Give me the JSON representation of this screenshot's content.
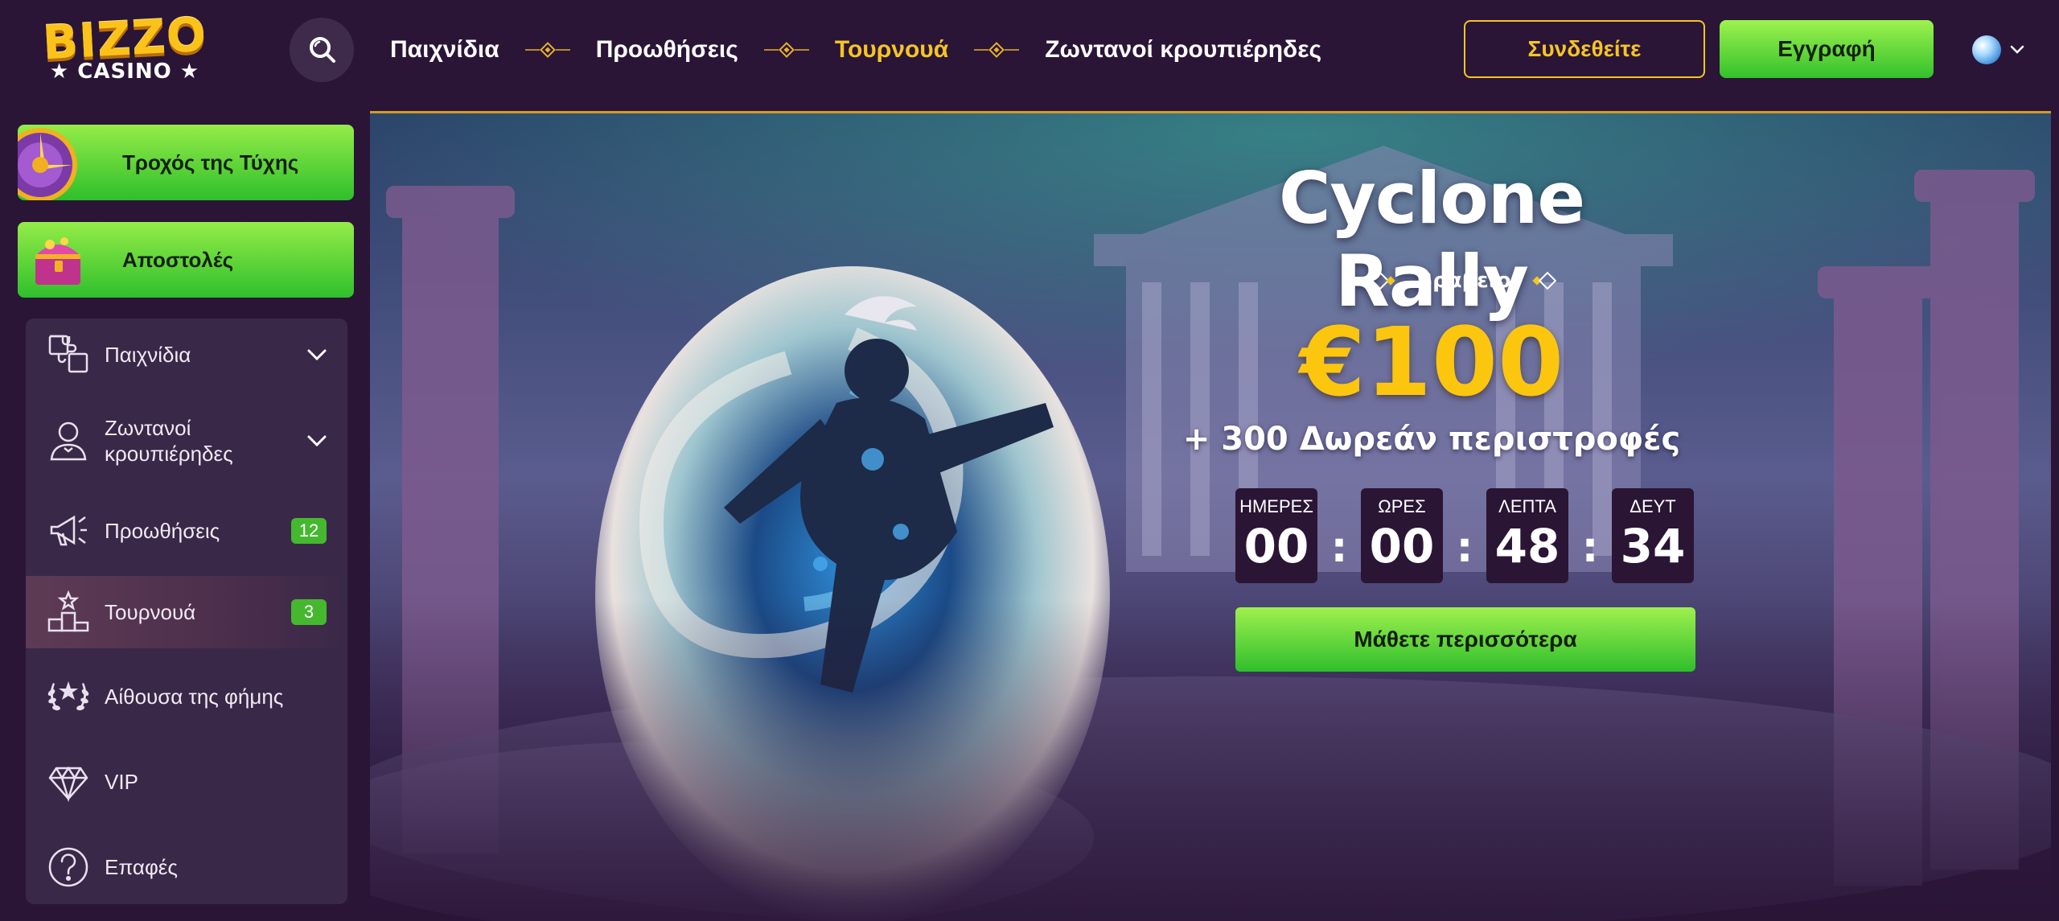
{
  "brand": {
    "logo_line1": "BIZZO",
    "logo_line2": "★ CASINO ★",
    "accent": "#f5c523",
    "green": "#3cc62e",
    "background": "#2a1537"
  },
  "header": {
    "nav": [
      {
        "label": "Παιχνίδια",
        "active": false
      },
      {
        "label": "Προωθήσεις",
        "active": false
      },
      {
        "label": "Τουρνουά",
        "active": true
      },
      {
        "label": "Ζωντανοί κρουπιέρηδες",
        "active": false
      }
    ],
    "login_label": "Συνδεθείτε",
    "register_label": "Εγγραφή",
    "language_icon": "globe-icon"
  },
  "sidebar": {
    "promos": [
      {
        "label": "Τροχός της Τύχης",
        "icon": "wheel-of-fortune-icon"
      },
      {
        "label": "Αποστολές",
        "icon": "treasure-chest-icon"
      }
    ],
    "menu": [
      {
        "label": "Παιχνίδια",
        "icon": "puzzle-icon",
        "expandable": true
      },
      {
        "label": "Ζωντανοί κρουπιέρηδες",
        "icon": "dealer-icon",
        "expandable": true
      },
      {
        "label": "Προωθήσεις",
        "icon": "megaphone-icon",
        "badge": "12"
      },
      {
        "label": "Τουρνουά",
        "icon": "podium-icon",
        "badge": "3",
        "active": true
      },
      {
        "label": "Αίθουσα της φήμης",
        "icon": "laurel-icon"
      },
      {
        "label": "VIP",
        "icon": "diamond-icon"
      },
      {
        "label": "Επαφές",
        "icon": "help-icon"
      }
    ]
  },
  "hero": {
    "title": "Cyclone Rally",
    "prize_label": "Βραβείο",
    "prize_amount": "€100",
    "prize_spins": "+ 300 Δωρεάν περιστροφές",
    "countdown": [
      {
        "label": "ΗΜΕΡΕΣ",
        "value": "00"
      },
      {
        "label": "ΩΡΕΣ",
        "value": "00"
      },
      {
        "label": "ΛΕΠΤΑ",
        "value": "48"
      },
      {
        "label": "ΔΕΥΤ",
        "value": "34"
      }
    ],
    "countdown_separator": ":",
    "cta_label": "Μάθετε περισσότερα"
  }
}
